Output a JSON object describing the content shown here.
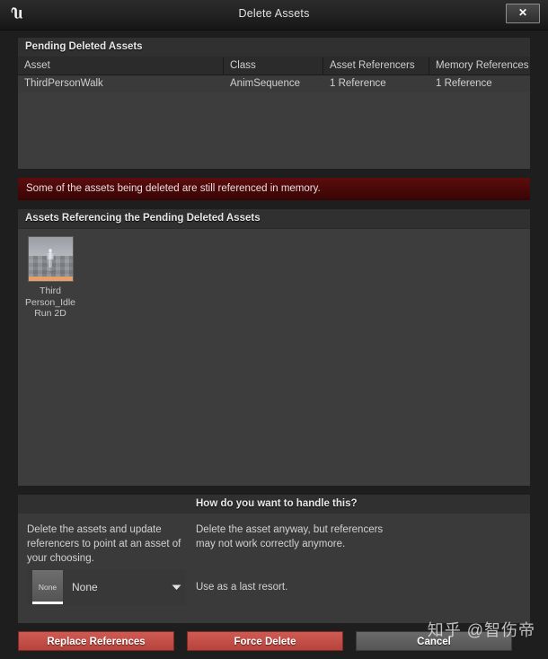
{
  "window": {
    "title": "Delete Assets",
    "logo_icon": "unreal-engine-logo",
    "close_icon": "✕"
  },
  "pending_section": {
    "header": "Pending Deleted Assets",
    "columns": [
      "Asset",
      "Class",
      "Asset Referencers",
      "Memory References"
    ],
    "rows": [
      {
        "asset": "ThirdPersonWalk",
        "class": "AnimSequence",
        "asset_referencers": "1 Reference",
        "memory_references": "1 Reference"
      }
    ]
  },
  "warning": {
    "message": "Some of the assets being deleted are still referenced in memory.",
    "color": "#5c0d0d"
  },
  "referencing_section": {
    "header": "Assets Referencing the Pending Deleted Assets",
    "tiles": [
      {
        "label": "Third Person_Idle Run 2D",
        "thumbnail_icon": "mannequin-thumbnail",
        "type_color": "#e5a06a"
      }
    ]
  },
  "handle_section": {
    "header": "How do you want to handle this?",
    "option_replace_description": "Delete the assets and update referencers to point at an asset of your choosing.",
    "option_force_description": "Delete the asset anyway, but referencers may not work correctly anymore.",
    "option_force_note": "Use as a last resort.",
    "picker": {
      "thumbnail_label": "None",
      "value": "None",
      "arrow_icon": "chevron-down-icon"
    }
  },
  "footer": {
    "replace_label": "Replace References",
    "force_label": "Force Delete",
    "cancel_label": "Cancel",
    "danger_color": "#c4504a"
  },
  "watermark": {
    "text": "知乎 @智伤帝"
  }
}
